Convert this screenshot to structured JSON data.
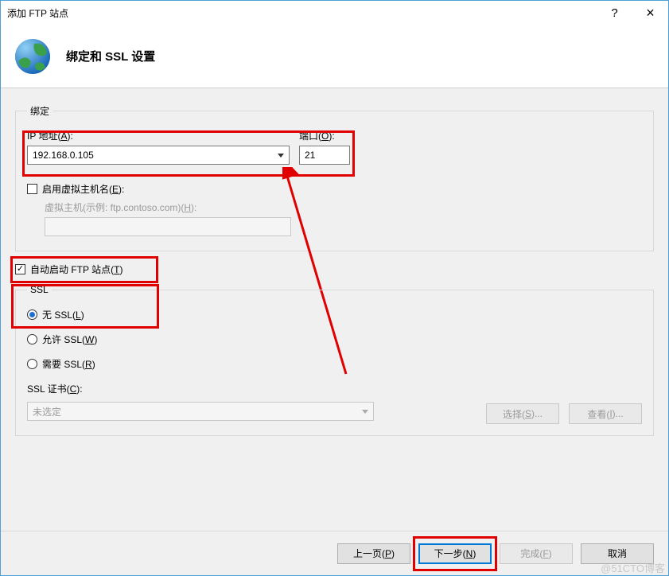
{
  "window": {
    "title": "添加 FTP 站点",
    "help": "?",
    "close": "×"
  },
  "header": {
    "title": "绑定和 SSL 设置"
  },
  "binding_group": {
    "legend": "绑定",
    "ip_label_pre": "IP 地址(",
    "ip_label_key": "A",
    "ip_label_post": "):",
    "ip_value": "192.168.0.105",
    "port_label_pre": "端口(",
    "port_label_key": "O",
    "port_label_post": "):",
    "port_value": "21",
    "vhost_check_pre": "启用虚拟主机名(",
    "vhost_check_key": "E",
    "vhost_check_post": "):",
    "vhost_label_pre": "虚拟主机(示例: ftp.contoso.com)(",
    "vhost_label_key": "H",
    "vhost_label_post": "):",
    "vhost_value": ""
  },
  "autostart": {
    "label_pre": "自动启动 FTP 站点(",
    "label_key": "T",
    "label_post": ")"
  },
  "ssl_group": {
    "legend": "SSL",
    "none_pre": "无 SSL(",
    "none_key": "L",
    "none_post": ")",
    "allow_pre": "允许 SSL(",
    "allow_key": "W",
    "allow_post": ")",
    "require_pre": "需要 SSL(",
    "require_key": "R",
    "require_post": ")",
    "cert_label_pre": "SSL 证书(",
    "cert_label_key": "C",
    "cert_label_post": "):",
    "cert_value": "未选定",
    "select_btn_pre": "选择(",
    "select_btn_key": "S",
    "select_btn_post": ")...",
    "view_btn_pre": "查看(",
    "view_btn_key": "I",
    "view_btn_post": ")..."
  },
  "footer": {
    "prev_pre": "上一页(",
    "prev_key": "P",
    "prev_post": ")",
    "next_pre": "下一步(",
    "next_key": "N",
    "next_post": ")",
    "finish_pre": "完成(",
    "finish_key": "F",
    "finish_post": ")",
    "cancel": "取消"
  },
  "watermark": "@51CTO博客"
}
